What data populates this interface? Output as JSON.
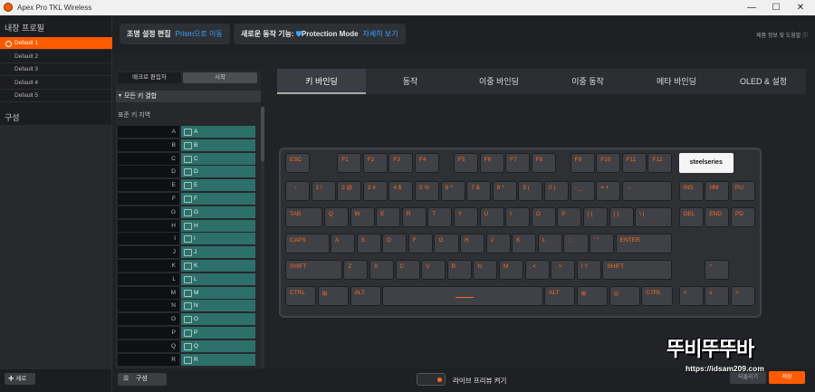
{
  "window": {
    "title": "Apex Pro TKL Wireless",
    "minimize": "—",
    "maximize": "☐",
    "close": "✕"
  },
  "sidebar": {
    "profiles_title": "내장 프로필",
    "profiles": [
      "Default 1",
      "Default 2",
      "Default 3",
      "Default 4",
      "Default 5"
    ],
    "config_title": "구성",
    "new_button": "새로"
  },
  "topbar": {
    "lighting_label": "조명 설정 편집",
    "lighting_link": "Prism으로 이동",
    "new_feature_label": "새로운 동작 기능:",
    "new_feature_name": "Protection Mode",
    "new_feature_link": "자세히 보기",
    "help": "제품 정보 및 도움말"
  },
  "macro_panel": {
    "tab_macro_editor": "매크로 편집자",
    "tab_start": "시작",
    "all_keys": "모든 키 결합",
    "standard_area": "표준 키 지역",
    "keys": [
      "A",
      "B",
      "C",
      "D",
      "E",
      "F",
      "G",
      "H",
      "I",
      "J",
      "K",
      "L",
      "M",
      "N",
      "O",
      "P",
      "Q",
      "R"
    ]
  },
  "tabs": [
    "키 바인딩",
    "동작",
    "이중 바인딩",
    "이중 동작",
    "메타 바인딩",
    "OLED & 설정"
  ],
  "keyboard": {
    "brand": "steelseries",
    "row0": [
      "ESC",
      "F1",
      "F2",
      "F3",
      "F4",
      "F5",
      "F6",
      "F7",
      "F8",
      "F9",
      "F10",
      "F11",
      "F12"
    ],
    "row1": [
      "` ~",
      "1 !",
      "2 @",
      "3 #",
      "4 $",
      "5 %",
      "6 ^",
      "7 &",
      "8 *",
      "9 (",
      "0 )",
      "- _",
      "= +",
      "←",
      "INS",
      "HM",
      "PU"
    ],
    "row2": [
      "TAB",
      "Q",
      "W",
      "E",
      "R",
      "T",
      "Y",
      "U",
      "I",
      "O",
      "P",
      "[ {",
      "] }",
      "\\ |",
      "DEL",
      "END",
      "PD"
    ],
    "row3": [
      "CAPS",
      "A",
      "S",
      "D",
      "F",
      "G",
      "H",
      "J",
      "K",
      "L",
      "; :",
      "' \"",
      "ENTER"
    ],
    "row4": [
      "SHIFT",
      "Z",
      "X",
      "C",
      "V",
      "B",
      "N",
      "M",
      ", <",
      ". >",
      "/ ?",
      "SHIFT",
      "^"
    ],
    "row5": [
      "CTRL",
      "⊞",
      "ALT",
      "ALT",
      "⊞",
      "◎",
      "CTRL",
      "<",
      "v",
      ">"
    ]
  },
  "bottombar": {
    "config_button": "구성",
    "live_preview": "라이브 프리뷰 켜기",
    "revert": "되돌리기",
    "save": "저장"
  },
  "watermark": {
    "line1": "뚜비뚜뚜바",
    "line2": "https://idsam209.com"
  }
}
